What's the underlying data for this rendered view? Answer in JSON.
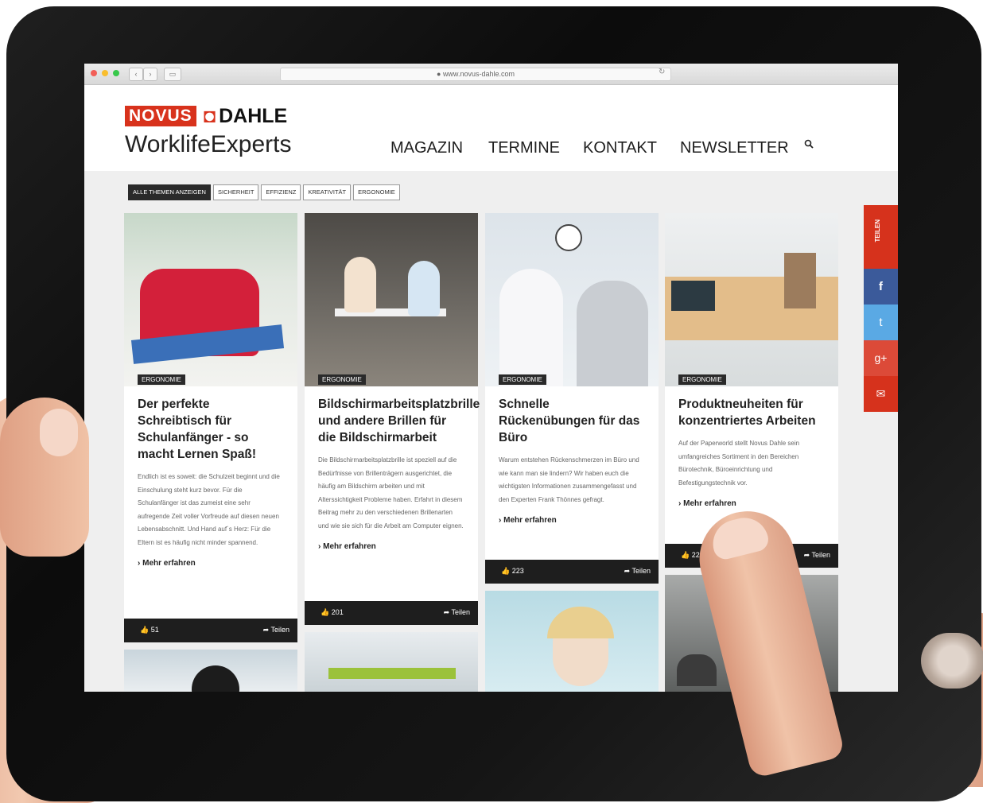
{
  "browser": {
    "url": "www.novus-dahle.com",
    "back_label": "‹",
    "forward_label": "›",
    "sidebar_label": "▭"
  },
  "brand": {
    "novus": "NOVUS",
    "dahle": "DAHLE",
    "tagline": "WorklifeExperts"
  },
  "nav": {
    "items": [
      "MAGAZIN",
      "TERMINE",
      "KONTAKT",
      "NEWSLETTER"
    ]
  },
  "filters": [
    "ALLE THEMEN ANZEIGEN",
    "SICHERHEIT",
    "EFFIZIENZ",
    "KREATIVITÄT",
    "ERGONOMIE"
  ],
  "cards": [
    {
      "category": "ERGONOMIE",
      "title": "Der perfekte Schreibtisch für Schulanfänger - so macht Lernen Spaß!",
      "excerpt": "Endlich ist es soweit: die Schulzeit beginnt und die Einschulung steht kurz bevor. Für die Schulanfänger ist das zumeist eine sehr aufregende Zeit voller Vorfreude auf diesen neuen Lebensabschnitt. Und Hand auf´s Herz: Für die Eltern ist es häufig nicht minder spannend.",
      "more": "Mehr erfahren",
      "likes": "51",
      "share": "Teilen"
    },
    {
      "category": "ERGONOMIE",
      "title": "Bildschirmarbeitsplatzbrille und andere Brillen für die Bildschirmarbeit",
      "excerpt": "Die Bildschirmarbeitsplatzbrille ist speziell auf die Bedürfnisse von Brillenträgern ausgerichtet, die häufig am Bildschirm arbeiten und mit Alterssichtigkeit Probleme haben. Erfahrt in diesem Beitrag mehr zu den verschiedenen Brillenarten und wie sie sich für die Arbeit am Computer eignen.",
      "more": "Mehr erfahren",
      "likes": "201",
      "share": "Teilen"
    },
    {
      "category": "ERGONOMIE",
      "title": "Schnelle Rückenübungen für das Büro",
      "excerpt": "Warum entstehen Rückenschmerzen im Büro und wie kann man sie lindern? Wir haben euch die wichtigsten Informationen zusammengefasst und den Experten Frank Thönnes gefragt.",
      "more": "Mehr erfahren",
      "likes": "223",
      "share": "Teilen"
    },
    {
      "category": "ERGONOMIE",
      "title": "Produktneuheiten für konzentriertes Arbeiten",
      "excerpt": "Auf der Paperworld stellt Novus Dahle sein umfangreiches Sortiment in den Bereichen Bürotechnik, Büroeinrichtung und Befestigungstechnik vor.",
      "more": "Mehr erfahren",
      "likes": "225",
      "share": "Teilen"
    }
  ],
  "social": {
    "teilen": "TEILEN",
    "facebook": "f",
    "twitter": "t",
    "googleplus": "g+",
    "mail": "✉"
  },
  "colors": {
    "brand_red": "#d8321c",
    "dark_bar": "#1e1e1e",
    "facebook": "#3b5a9a",
    "twitter": "#5aa9e4",
    "googleplus": "#dc4a38"
  },
  "icons": {
    "search": "magnifier",
    "like": "thumbs-up",
    "share": "share-arrow",
    "chevron": "chevron-right"
  }
}
